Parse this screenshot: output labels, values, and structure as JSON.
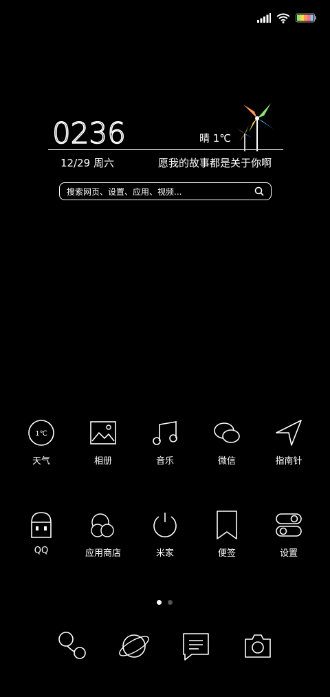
{
  "status_bar": {
    "signal_icon": "signal-icon",
    "wifi_icon": "wifi-icon",
    "battery_icon": "battery-icon"
  },
  "widget": {
    "time": "02:36",
    "weather": "晴 1℃",
    "date": "12/29 周六",
    "motto": "愿我的故事都是关于你啊",
    "search_placeholder": "搜索网页、设置、应用、视频..."
  },
  "apps_row1": [
    {
      "label": "天气",
      "icon": "weather-icon",
      "badge": "1℃"
    },
    {
      "label": "相册",
      "icon": "gallery-icon"
    },
    {
      "label": "音乐",
      "icon": "music-icon"
    },
    {
      "label": "微信",
      "icon": "wechat-icon"
    },
    {
      "label": "指南针",
      "icon": "compass-icon"
    }
  ],
  "apps_row2": [
    {
      "label": "QQ",
      "icon": "qq-icon"
    },
    {
      "label": "应用商店",
      "icon": "app-store-icon"
    },
    {
      "label": "米家",
      "icon": "mijia-icon"
    },
    {
      "label": "便签",
      "icon": "notes-icon"
    },
    {
      "label": "设置",
      "icon": "settings-icon"
    }
  ],
  "pages": {
    "count": 2,
    "active": 1
  },
  "dock": [
    {
      "icon": "phone-icon"
    },
    {
      "icon": "browser-icon"
    },
    {
      "icon": "messages-icon"
    },
    {
      "icon": "camera-icon"
    }
  ]
}
